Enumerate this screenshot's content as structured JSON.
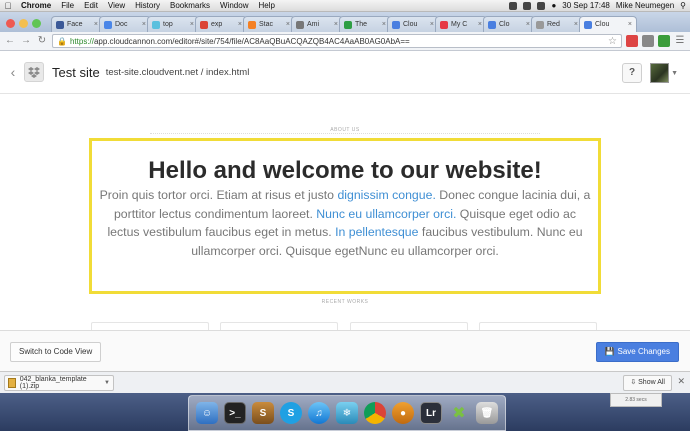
{
  "menubar": {
    "app": "Chrome",
    "items": [
      "File",
      "Edit",
      "View",
      "History",
      "Bookmarks",
      "Window",
      "Help"
    ],
    "clock": "30 Sep  17:48",
    "user": "Mike Neumegen"
  },
  "tabs": [
    {
      "label": "Face",
      "color": "#3b5998"
    },
    {
      "label": "Doc",
      "color": "#4a86e8"
    },
    {
      "label": "top",
      "color": "#5bc0de"
    },
    {
      "label": "exp",
      "color": "#db4437"
    },
    {
      "label": "Stac",
      "color": "#f48024"
    },
    {
      "label": "Ami",
      "color": "#777777"
    },
    {
      "label": "The",
      "color": "#2e9e44"
    },
    {
      "label": "Clou",
      "color": "#4a7fe0"
    },
    {
      "label": "My C",
      "color": "#e63946"
    },
    {
      "label": "Clo",
      "color": "#4a7fe0"
    },
    {
      "label": "Red",
      "color": "#999999"
    },
    {
      "label": "Clou",
      "color": "#4a7fe0",
      "active": true
    }
  ],
  "address": {
    "scheme": "https://",
    "url_rest": "app.cloudcannon.com/editor#/site/754/file/AC8AaQBuACQAZQB4AC4AaAB0AG0AbA=="
  },
  "editor": {
    "site_name": "Test site",
    "breadcrumb": "test-site.cloudvent.net / index.html",
    "help_label": "?"
  },
  "preview": {
    "about_label": "ABOUT US",
    "hero_title": "Hello and welcome to our website!",
    "hero_parts": [
      {
        "text": "Proin quis tortor orci. Etiam at risus et justo ",
        "link": false
      },
      {
        "text": "dignissim congue.",
        "link": true
      },
      {
        "text": " Donec congue lacinia dui, a porttitor lectus condimentum laoreet. ",
        "link": false
      },
      {
        "text": "Nunc eu ullamcorper orci.",
        "link": true
      },
      {
        "text": " Quisque eget odio ac lectus vestibulum faucibus eget in metus. ",
        "link": false
      },
      {
        "text": "In pellentesque",
        "link": true
      },
      {
        "text": " faucibus vestibulum. Nunc eu ullamcorper orci. Quisque egetNunc eu ullamcorper orci.",
        "link": false
      }
    ],
    "recent_label": "RECENT WORKS"
  },
  "actions": {
    "code_view_label": "Switch to Code View",
    "save_label": "Save Changes"
  },
  "downloads": {
    "file_name": "042_blanka_template (1).zip",
    "show_all_label": "Show All"
  },
  "desktop": {
    "bg_window_text": "2.83 secs"
  },
  "colors": {
    "accent": "#4a7fe0",
    "hero_border": "#f1dc37",
    "link": "#3f8fd4"
  }
}
